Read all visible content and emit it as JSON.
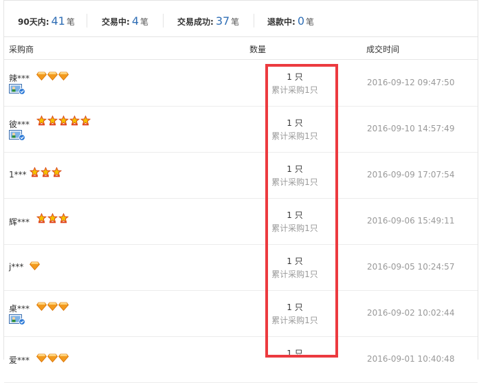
{
  "stats": [
    {
      "label": "90天内:",
      "value": "41",
      "unit": "笔"
    },
    {
      "label": "交易中:",
      "value": "4",
      "unit": "笔"
    },
    {
      "label": "交易成功:",
      "value": "37",
      "unit": "笔"
    },
    {
      "label": "退款中:",
      "value": "0",
      "unit": "笔"
    }
  ],
  "columns": {
    "buyer": "采购商",
    "quantity": "数量",
    "time": "成交时间"
  },
  "colors": {
    "accent_number": "#2f6eb5",
    "highlight_box": "#ec3a3f",
    "diamond": "#f29a1f",
    "crown": "#f5c000"
  },
  "rows": [
    {
      "buyer": "辣***",
      "badge": "diamond-icon",
      "badge_count": 3,
      "verified": true,
      "qty": "1 只",
      "cumulative": "累计采购1只",
      "time": "2016-09-12 09:47:50"
    },
    {
      "buyer": "彼***",
      "badge": "crown-icon",
      "badge_count": 5,
      "verified": true,
      "qty": "1 只",
      "cumulative": "累计采购1只",
      "time": "2016-09-10 14:57:49"
    },
    {
      "buyer": "1***",
      "badge": "crown-icon",
      "badge_count": 3,
      "verified": false,
      "qty": "1 只",
      "cumulative": "累计采购1只",
      "time": "2016-09-09 17:07:54"
    },
    {
      "buyer": "辉***",
      "badge": "crown-icon",
      "badge_count": 3,
      "verified": false,
      "qty": "1 只",
      "cumulative": "累计采购1只",
      "time": "2016-09-06 15:49:11"
    },
    {
      "buyer": "j***",
      "badge": "diamond-icon",
      "badge_count": 1,
      "verified": false,
      "qty": "1 只",
      "cumulative": "累计采购1只",
      "time": "2016-09-05 10:24:57"
    },
    {
      "buyer": "桌***",
      "badge": "diamond-icon",
      "badge_count": 3,
      "verified": true,
      "qty": "1 只",
      "cumulative": "累计采购1只",
      "time": "2016-09-02 10:02:44"
    },
    {
      "buyer": "爱***",
      "badge": "diamond-icon",
      "badge_count": 3,
      "verified": false,
      "qty": "1 只",
      "cumulative": "",
      "time": "2016-09-01 10:40:48"
    }
  ]
}
